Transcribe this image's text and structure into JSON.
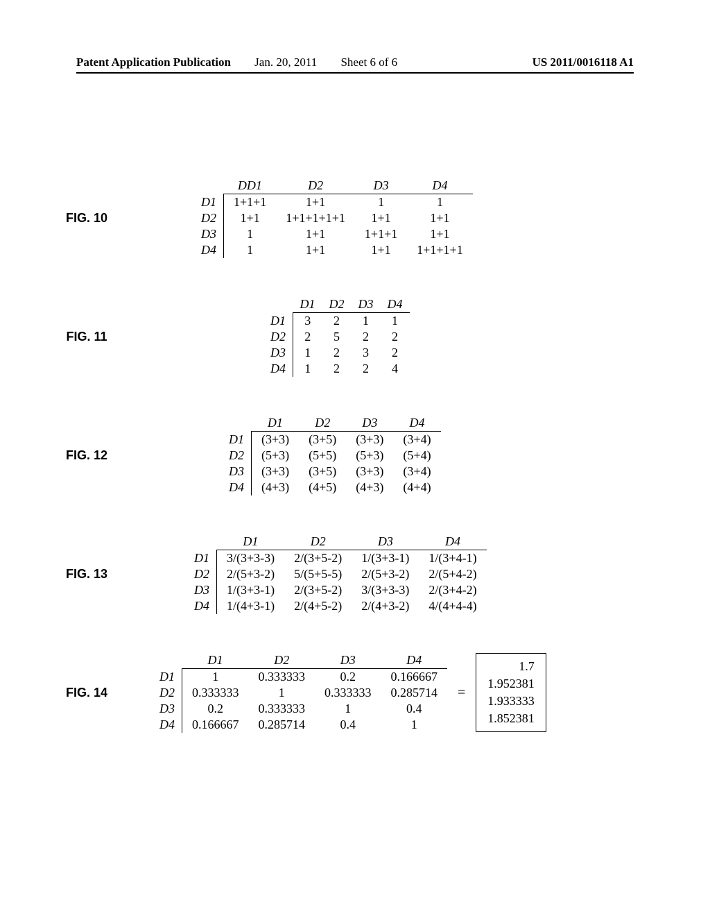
{
  "header": {
    "pub": "Patent Application Publication",
    "date": "Jan. 20, 2011",
    "sheet": "Sheet 6 of 6",
    "docnum": "US 2011/0016118 A1"
  },
  "figs": {
    "f10": {
      "label": "FIG. 10",
      "cols": [
        "D1",
        "D2",
        "D3",
        "D4"
      ],
      "rows": [
        "D1",
        "D2",
        "D3",
        "D4"
      ],
      "cells": [
        [
          "1+1+1",
          "1+1",
          "1",
          "1"
        ],
        [
          "1+1",
          "1+1+1+1+1",
          "1+1",
          "1+1"
        ],
        [
          "1",
          "1+1",
          "1+1+1",
          "1+1"
        ],
        [
          "1",
          "1+1",
          "1+1",
          "1+1+1+1"
        ]
      ]
    },
    "f11": {
      "label": "FIG. 11",
      "cols": [
        "D1",
        "D2",
        "D3",
        "D4"
      ],
      "rows": [
        "D1",
        "D2",
        "D3",
        "D4"
      ],
      "cells": [
        [
          "3",
          "2",
          "1",
          "1"
        ],
        [
          "2",
          "5",
          "2",
          "2"
        ],
        [
          "1",
          "2",
          "3",
          "2"
        ],
        [
          "1",
          "2",
          "2",
          "4"
        ]
      ]
    },
    "f12": {
      "label": "FIG. 12",
      "cols": [
        "D1",
        "D2",
        "D3",
        "D4"
      ],
      "rows": [
        "D1",
        "D2",
        "D3",
        "D4"
      ],
      "cells": [
        [
          "(3+3)",
          "(3+5)",
          "(3+3)",
          "(3+4)"
        ],
        [
          "(5+3)",
          "(5+5)",
          "(5+3)",
          "(5+4)"
        ],
        [
          "(3+3)",
          "(3+5)",
          "(3+3)",
          "(3+4)"
        ],
        [
          "(4+3)",
          "(4+5)",
          "(4+3)",
          "(4+4)"
        ]
      ]
    },
    "f13": {
      "label": "FIG. 13",
      "cols": [
        "D1",
        "D2",
        "D3",
        "D4"
      ],
      "rows": [
        "D1",
        "D2",
        "D3",
        "D4"
      ],
      "cells": [
        [
          "3/(3+3-3)",
          "2/(3+5-2)",
          "1/(3+3-1)",
          "1/(3+4-1)"
        ],
        [
          "2/(5+3-2)",
          "5/(5+5-5)",
          "2/(5+3-2)",
          "2/(5+4-2)"
        ],
        [
          "1/(3+3-1)",
          "2/(3+5-2)",
          "3/(3+3-3)",
          "2/(3+4-2)"
        ],
        [
          "1/(4+3-1)",
          "2/(4+5-2)",
          "2/(4+3-2)",
          "4/(4+4-4)"
        ]
      ]
    },
    "f14": {
      "label": "FIG. 14",
      "cols": [
        "D1",
        "D2",
        "D3",
        "D4"
      ],
      "rows": [
        "D1",
        "D2",
        "D3",
        "D4"
      ],
      "cells": [
        [
          "1",
          "0.333333",
          "0.2",
          "0.166667"
        ],
        [
          "0.333333",
          "1",
          "0.333333",
          "0.285714"
        ],
        [
          "0.2",
          "0.333333",
          "1",
          "0.4"
        ],
        [
          "0.166667",
          "0.285714",
          "0.4",
          "1"
        ]
      ],
      "eq": "=",
      "result": [
        "1.7",
        "1.952381",
        "1.933333",
        "1.852381"
      ]
    }
  }
}
